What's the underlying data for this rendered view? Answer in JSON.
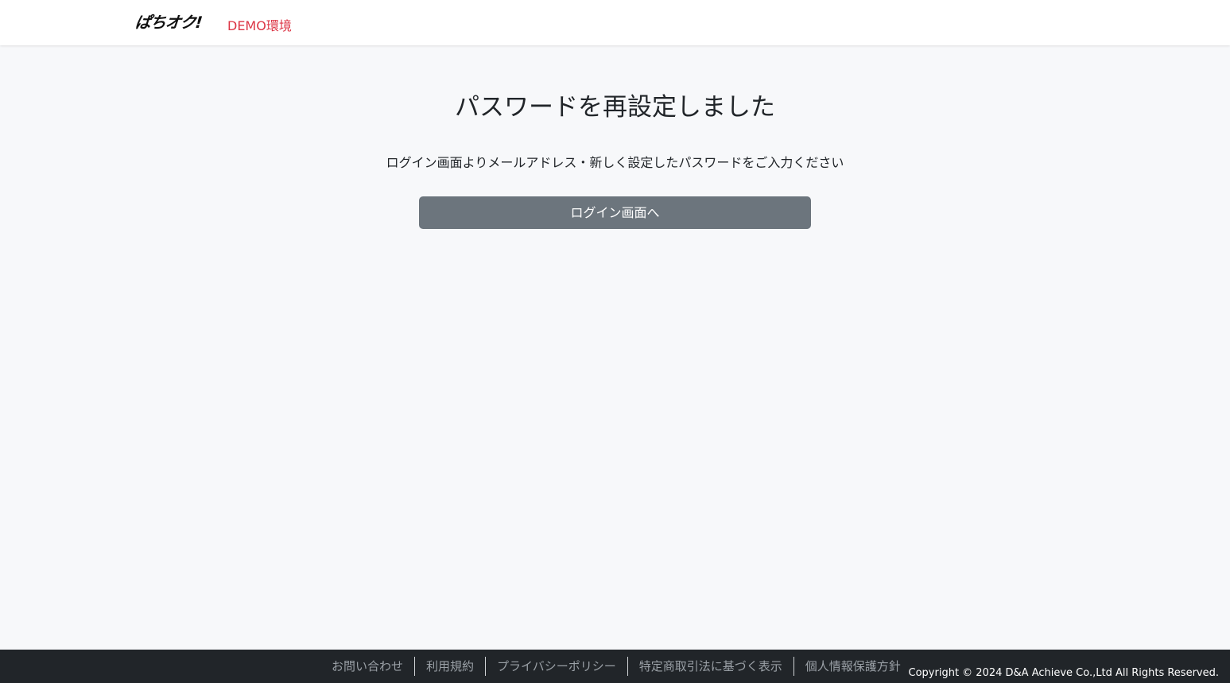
{
  "header": {
    "logo_text": "ぱちオク!",
    "env_label": "DEMO環境"
  },
  "main": {
    "title": "パスワードを再設定しました",
    "message": "ログイン画面よりメールアドレス・新しく設定したパスワードをご入力ください",
    "login_button_label": "ログイン画面へ"
  },
  "footer": {
    "links": [
      {
        "label": "お問い合わせ"
      },
      {
        "label": "利用規約"
      },
      {
        "label": "プライバシーポリシー"
      },
      {
        "label": "特定商取引法に基づく表示"
      },
      {
        "label": "個人情報保護方針"
      }
    ],
    "copyright": "Copyright © 2024 D&A Achieve Co.,Ltd All Rights Reserved."
  },
  "colors": {
    "env_label": "#dc3545",
    "button_bg": "#6c757d",
    "footer_bg": "#212529",
    "page_bg": "#f7f8fa"
  }
}
